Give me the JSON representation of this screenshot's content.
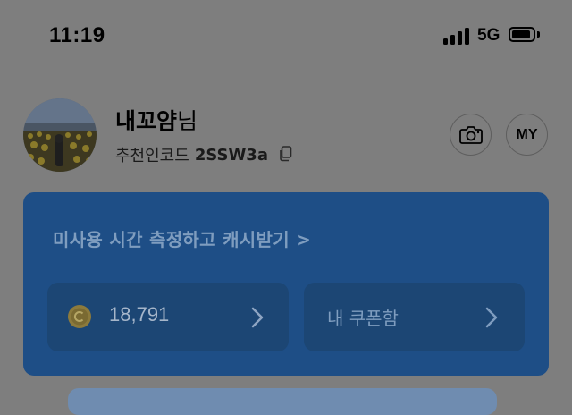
{
  "status_bar": {
    "time": "11:19",
    "network": "5G"
  },
  "profile": {
    "name": "내꼬얌",
    "name_suffix": "님",
    "referral_label": "추천인코드",
    "referral_code": "2SSW3a",
    "camera_icon": "camera-icon",
    "my_button": "MY"
  },
  "card": {
    "headline": "미사용 시간 측정하고 캐시받기 >",
    "points": {
      "value": "18,791",
      "icon": "coin-icon"
    },
    "coupon": {
      "label": "내 쿠폰함"
    }
  },
  "colors": {
    "background": "#7e7e7e",
    "card": "#1e4e86",
    "sub_card": "#1c4674"
  }
}
